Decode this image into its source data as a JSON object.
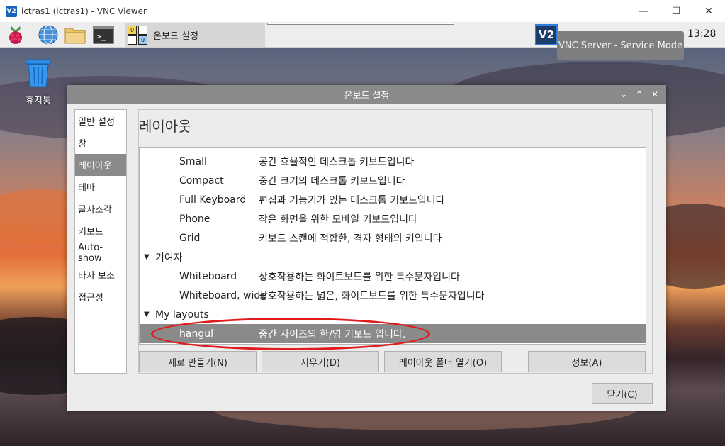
{
  "vnc": {
    "logo": "V2",
    "title": "ictras1 (ictras1) - VNC Viewer",
    "minimize": "—",
    "maximize": "☐",
    "close": "✕"
  },
  "taskbar": {
    "icons": [
      "raspberry-menu-icon",
      "web-browser-icon",
      "file-manager-icon",
      "terminal-icon"
    ],
    "task_label": "온보드 설정",
    "osk_keys": [
      "0",
      "",
      "",
      "0"
    ],
    "vnc_tray": "V2",
    "time": "13:28"
  },
  "tooltip": {
    "text": "VNC Server - Service Mode"
  },
  "desktop": {
    "trash_label": "휴지통"
  },
  "dialog": {
    "title": "온보드 설정",
    "controls": [
      "⌄",
      "⌃",
      "✕"
    ],
    "sidebar": [
      {
        "label": "일반 설정",
        "selected": false
      },
      {
        "label": "창",
        "selected": false
      },
      {
        "label": "레이아웃",
        "selected": true
      },
      {
        "label": "테마",
        "selected": false
      },
      {
        "label": "글자조각",
        "selected": false
      },
      {
        "label": "키보드",
        "selected": false
      },
      {
        "label": "Auto-show",
        "selected": false
      },
      {
        "label": "타자 보조",
        "selected": false
      },
      {
        "label": "접근성",
        "selected": false
      }
    ],
    "section_title": "레이아웃",
    "layouts": [
      {
        "type": "item",
        "name": "Small",
        "desc": "공간 효율적인 데스크톱 키보드입니다"
      },
      {
        "type": "item",
        "name": "Compact",
        "desc": "중간 크기의 데스크톱 키보드입니다"
      },
      {
        "type": "item",
        "name": "Full Keyboard",
        "desc": "편집과 기능키가 있는 데스크톱 키보드입니다"
      },
      {
        "type": "item",
        "name": "Phone",
        "desc": "작은 화면을 위한 모바일 키보드입니다"
      },
      {
        "type": "item",
        "name": "Grid",
        "desc": "키보드 스캔에 적합한, 격자 형태의 키입니다"
      },
      {
        "type": "header",
        "name": "기여자",
        "desc": ""
      },
      {
        "type": "item",
        "name": "Whiteboard",
        "desc": "상호작용하는 화이트보드를 위한 특수문자입니다"
      },
      {
        "type": "item",
        "name": "Whiteboard, wide",
        "desc": "상호작용하는 넓은, 화이트보드를 위한 특수문자입니다"
      },
      {
        "type": "header",
        "name": "My layouts",
        "desc": ""
      },
      {
        "type": "selected",
        "name": "hangul",
        "desc": "중간 사이즈의 한/영 키보드 입니다."
      }
    ],
    "buttons": {
      "new": "새로 만들기(N)",
      "delete": "지우기(D)",
      "open_folder": "레이아웃 폴더 열기(O)",
      "info": "정보(A)",
      "close": "닫기(C)"
    }
  }
}
